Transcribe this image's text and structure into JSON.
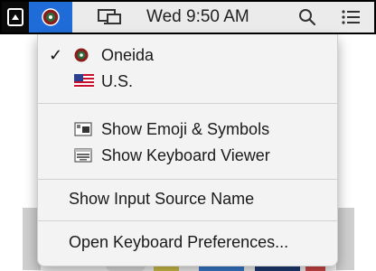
{
  "menubar": {
    "clock": "Wed 9:50 AM"
  },
  "menu": {
    "items": [
      {
        "label": "Oneida",
        "checked": true,
        "icon": "oneida-flag-icon"
      },
      {
        "label": "U.S.",
        "checked": false,
        "icon": "us-flag-icon"
      },
      {
        "label": "Show Emoji & Symbols",
        "icon": "emoji-viewer-icon"
      },
      {
        "label": "Show Keyboard Viewer",
        "icon": "keyboard-viewer-icon"
      },
      {
        "label": "Show Input Source Name"
      },
      {
        "label": "Open Keyboard Preferences..."
      }
    ],
    "check_glyph": "✓"
  },
  "colors": {
    "selected_menubar": "#1f6bd8",
    "menu_bg": "#f3f3f3"
  }
}
